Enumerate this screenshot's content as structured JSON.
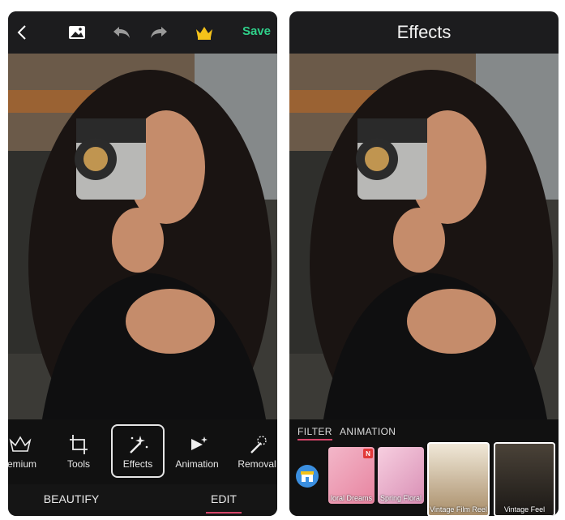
{
  "left_panel": {
    "topbar": {
      "back_icon": "chevron-left-icon",
      "gallery_icon": "image-icon",
      "undo_icon": "undo-icon",
      "redo_icon": "redo-icon",
      "crown_icon": "crown-icon",
      "save_label": "Save",
      "save_color": "#2fd08a"
    },
    "tools": [
      {
        "label": "remium",
        "icon": "crown-outline-icon"
      },
      {
        "label": "Tools",
        "icon": "crop-icon"
      },
      {
        "label": "Effects",
        "icon": "magic-wand-icon",
        "active": true
      },
      {
        "label": "Animation",
        "icon": "play-sparkle-icon"
      },
      {
        "label": "Removal",
        "icon": "eraser-wand-icon"
      }
    ],
    "nav": {
      "beautify_label": "BEAUTIFY",
      "edit_label": "EDIT",
      "active": "EDIT",
      "accent": "#d6456a"
    }
  },
  "right_panel": {
    "title": "Effects",
    "tabs": {
      "filter_label": "FILTER",
      "animation_label": "ANIMATION",
      "active": "FILTER"
    },
    "store_icon": "store-icon",
    "effects": [
      {
        "label": "loral Dreams",
        "badge": "N"
      },
      {
        "label": "Spring Floral"
      },
      {
        "label": "Vintage Film Reel",
        "selected": true
      },
      {
        "label": "Vintage Feel",
        "selected": true
      }
    ]
  }
}
